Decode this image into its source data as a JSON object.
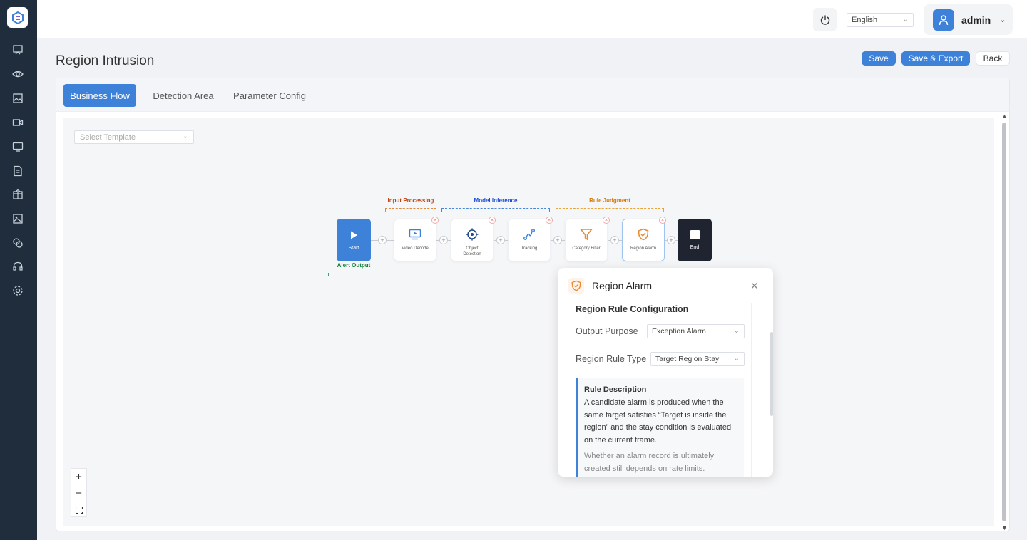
{
  "sidebar": {
    "items": [
      {
        "icon": "monitor-stand-icon"
      },
      {
        "icon": "eye-icon"
      },
      {
        "icon": "image-icon"
      },
      {
        "icon": "video-camera-icon"
      },
      {
        "icon": "display-icon"
      },
      {
        "icon": "document-icon"
      },
      {
        "icon": "package-icon"
      },
      {
        "icon": "gallery-icon"
      },
      {
        "icon": "layers-icon"
      },
      {
        "icon": "headset-icon"
      },
      {
        "icon": "gear-icon"
      }
    ]
  },
  "topbar": {
    "language": "English",
    "username": "admin"
  },
  "page": {
    "title": "Region Intrusion",
    "save_label": "Save",
    "save_export_label": "Save & Export",
    "back_label": "Back"
  },
  "tabs": [
    {
      "label": "Business Flow",
      "active": true
    },
    {
      "label": "Detection Area",
      "active": false
    },
    {
      "label": "Parameter Config",
      "active": false
    }
  ],
  "canvas": {
    "template_placeholder": "Select Template"
  },
  "flow": {
    "groups": [
      {
        "label": "Input Processing",
        "color": "#c2410c"
      },
      {
        "label": "Model Inference",
        "color": "#1d4ed8"
      },
      {
        "label": "Rule Judgment",
        "color": "#d97706"
      },
      {
        "label": "Alert Output",
        "color": "#15803d"
      }
    ],
    "start_label": "Start",
    "end_label": "End",
    "nodes": [
      {
        "label": "Video Decode",
        "icon": "video-decode-icon"
      },
      {
        "label": "Object Detection",
        "icon": "target-icon"
      },
      {
        "label": "Tracking",
        "icon": "tracking-icon"
      },
      {
        "label": "Category Filter",
        "icon": "funnel-icon"
      },
      {
        "label": "Region Alarm",
        "icon": "shield-check-icon"
      }
    ]
  },
  "popup": {
    "title": "Region Alarm",
    "section_title": "Region Rule Configuration",
    "output_purpose_label": "Output Purpose",
    "output_purpose_value": "Exception Alarm",
    "region_rule_type_label": "Region Rule Type",
    "region_rule_type_value": "Target Region Stay",
    "description_title": "Rule Description",
    "description_text": "A candidate alarm is produced when the same target satisfies “Target is inside the region” and the stay condition is evaluated on the current frame.",
    "description_note": "Whether an alarm record is ultimately created still depends on rate limits."
  },
  "colors": {
    "accent": "#3d82d8",
    "sidebar_bg": "#1f2d3d",
    "end_node": "#1f2430"
  }
}
